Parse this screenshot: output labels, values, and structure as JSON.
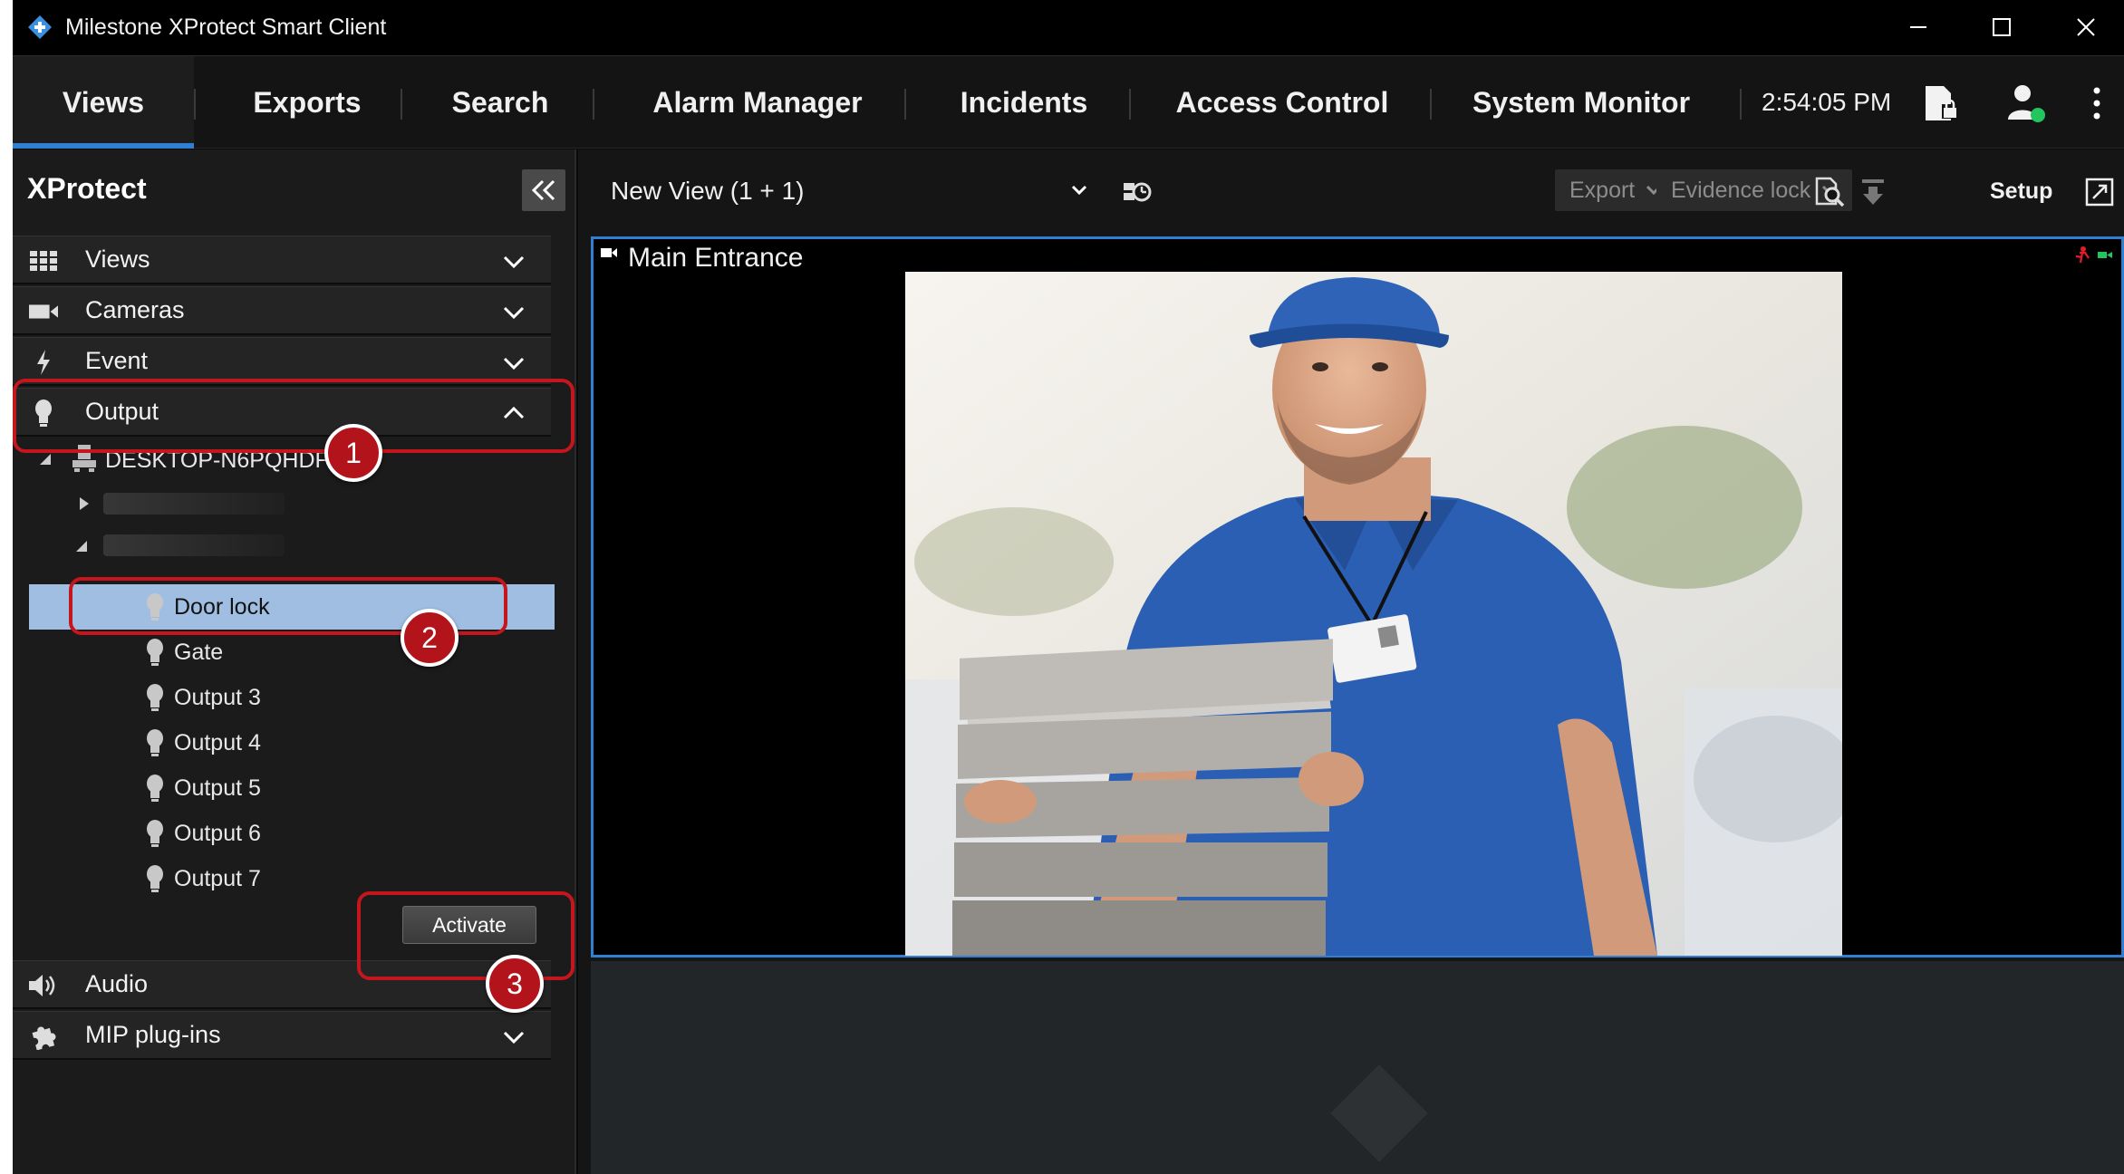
{
  "window": {
    "title": "Milestone XProtect Smart Client"
  },
  "tabs": [
    {
      "label": "Views",
      "active": true
    },
    {
      "label": "Exports"
    },
    {
      "label": "Search"
    },
    {
      "label": "Alarm Manager"
    },
    {
      "label": "Incidents"
    },
    {
      "label": "Access Control"
    },
    {
      "label": "System Monitor"
    }
  ],
  "clock": "2:54:05 PM",
  "left_panel": {
    "title": "XProtect",
    "sections": {
      "views": "Views",
      "cameras": "Cameras",
      "event": "Event",
      "output": "Output",
      "audio": "Audio",
      "mip": "MIP plug-ins"
    },
    "tree": {
      "server": "DESKTOP-N6PQHDF",
      "outputs": [
        "Door lock",
        "Gate",
        "Output 3",
        "Output 4",
        "Output 5",
        "Output 6",
        "Output 7"
      ],
      "selected": "Door lock"
    },
    "activate_label": "Activate"
  },
  "callouts": [
    "1",
    "2",
    "3"
  ],
  "view": {
    "name": "New View (1 + 1)",
    "export_label": "Export",
    "evidence_lock_label": "Evidence lock",
    "setup_label": "Setup",
    "camera_title": "Main Entrance"
  },
  "colors": {
    "accent": "#2f7fd3",
    "callout": "#c4161c",
    "selection": "#9fbee2",
    "status_online": "#22c55e"
  },
  "icons": [
    "milestone-logo-icon",
    "minimize-icon",
    "maximize-icon",
    "close-icon",
    "evidence-lock-icon",
    "user-status-icon",
    "more-vertical-icon",
    "collapse-double-chevron-icon",
    "grid-icon",
    "camera-icon",
    "lightning-icon",
    "bulb-icon",
    "server-icon",
    "speaker-icon",
    "puzzle-icon",
    "chevron-down-icon",
    "chevron-up-icon",
    "view-sequence-icon",
    "search-recording-icon",
    "download-icon",
    "fullscreen-icon"
  ]
}
